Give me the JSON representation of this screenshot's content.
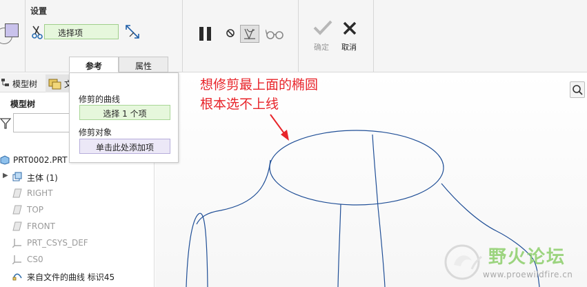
{
  "ribbon": {
    "settings_title": "设置",
    "select_field_value": "选择项",
    "tabs": [
      {
        "label": "参考",
        "active": true
      },
      {
        "label": "属性",
        "active": false
      }
    ],
    "ok_label": "确定",
    "cancel_label": "取消"
  },
  "popover": {
    "trim_curve_label": "修剪的曲线",
    "trim_curve_value": "选择 1 个项",
    "trim_object_label": "修剪对象",
    "trim_object_value": "单击此处添加项"
  },
  "left_panel": {
    "tabs": [
      {
        "label": "模型树"
      },
      {
        "label": "文"
      }
    ],
    "heading": "模型树",
    "filter_placeholder": "",
    "tree": [
      {
        "label": "PRT0002.PRT",
        "icon": "part-icon",
        "muted": false
      },
      {
        "label": "主体 (1)",
        "icon": "body-icon",
        "muted": false
      },
      {
        "label": "RIGHT",
        "icon": "datum-plane-icon",
        "muted": true
      },
      {
        "label": "TOP",
        "icon": "datum-plane-icon",
        "muted": true
      },
      {
        "label": "FRONT",
        "icon": "datum-plane-icon",
        "muted": true
      },
      {
        "label": "PRT_CSYS_DEF",
        "icon": "csys-icon",
        "muted": true
      },
      {
        "label": "CS0",
        "icon": "csys-icon",
        "muted": true
      },
      {
        "label": "来自文件的曲线 标识45",
        "icon": "curve-icon",
        "muted": false
      }
    ]
  },
  "canvas": {
    "annotation_line1": "想修剪最上面的椭圆",
    "annotation_line2": "根本选不上线",
    "curve_color": "#1f4e96",
    "annotation_color": "#e8242a"
  },
  "watermark": {
    "name": "野火论坛",
    "url": "www.proewildfire.cn"
  }
}
